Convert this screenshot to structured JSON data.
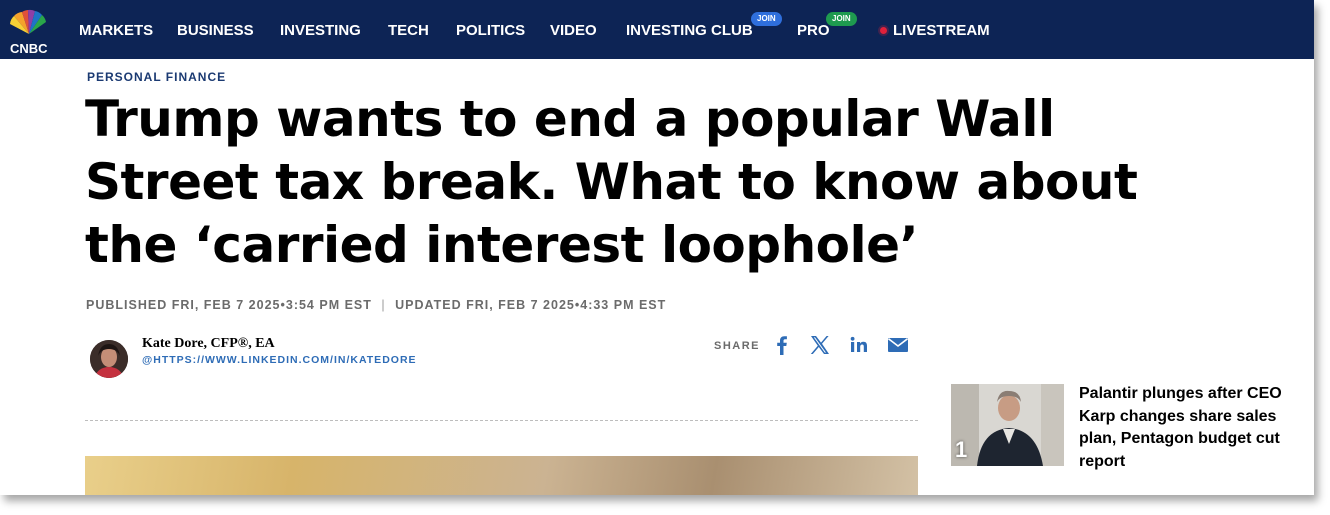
{
  "nav": {
    "logo": "CNBC",
    "items": [
      "MARKETS",
      "BUSINESS",
      "INVESTING",
      "TECH",
      "POLITICS",
      "VIDEO",
      "INVESTING CLUB",
      "PRO",
      "LIVESTREAM"
    ],
    "join_badge": "JOIN",
    "pro_badge": "JOIN"
  },
  "article": {
    "section": "PERSONAL FINANCE",
    "headline": "Trump wants to end a popular Wall Street tax break. What to know about the ‘carried interest loophole’",
    "published": "PUBLISHED FRI, FEB 7 2025•3:54 PM EST",
    "separator": "|",
    "updated": "UPDATED FRI, FEB 7 2025•4:33 PM EST",
    "author": {
      "name": "Kate Dore, CFP®, EA",
      "link": "@HTTPS://WWW.LINKEDIN.COM/IN/KATEDORE"
    },
    "share_label": "SHARE",
    "share_icons": [
      "facebook-icon",
      "x-icon",
      "linkedin-icon",
      "email-icon"
    ]
  },
  "trending": {
    "rank": "1",
    "title": "Palantir plunges after CEO Karp changes share sales plan, Pentagon budget cut report"
  },
  "colors": {
    "nav_bg": "#0d2455",
    "section": "#1b3a72",
    "link": "#2e6cb6",
    "live": "#e0213b"
  }
}
